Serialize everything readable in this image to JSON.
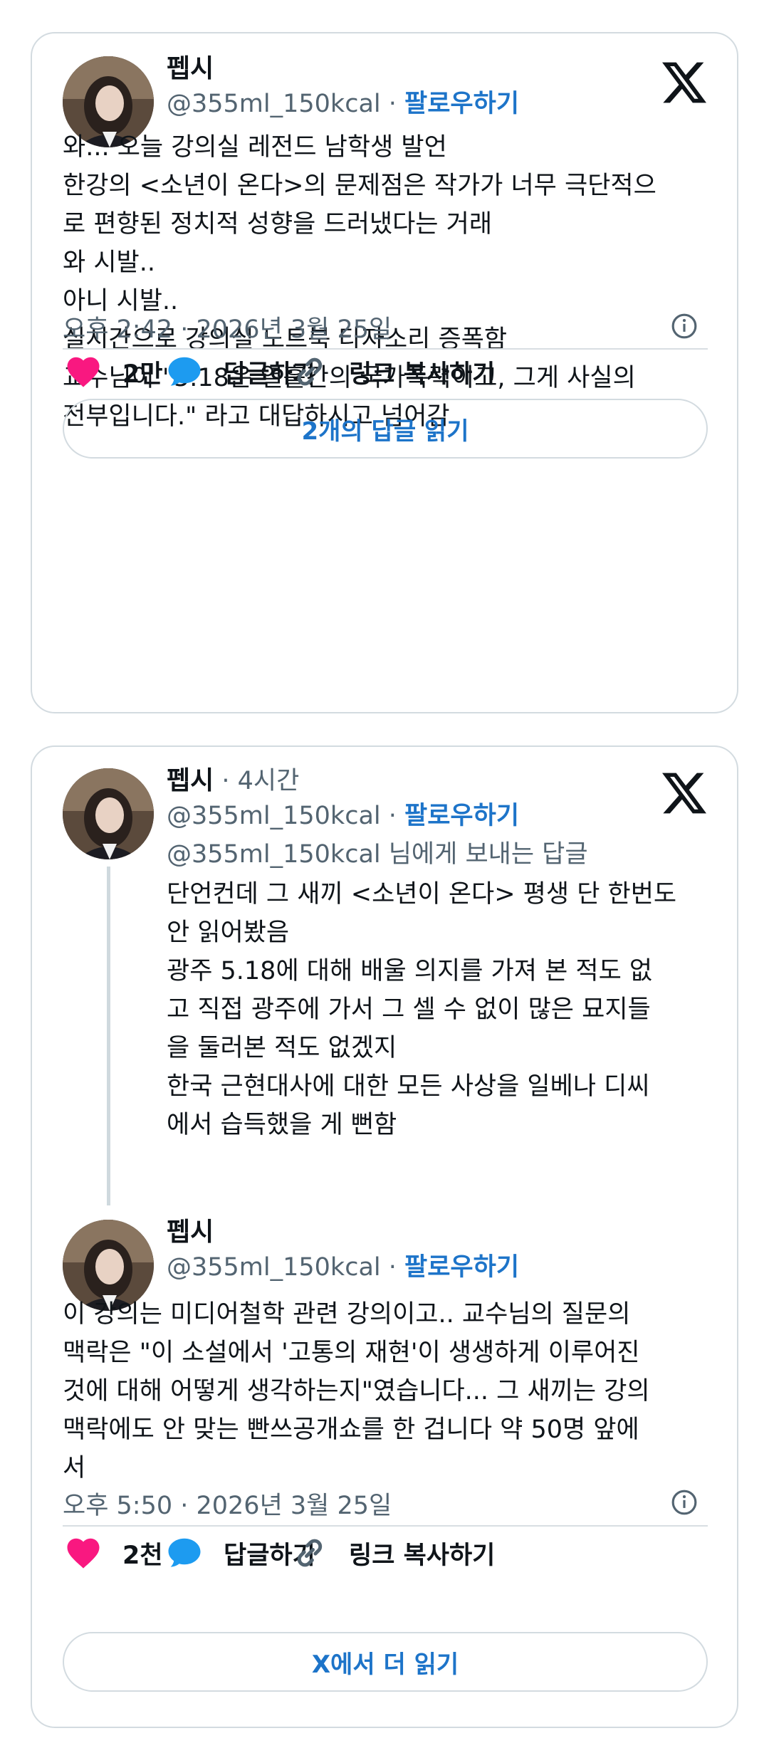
{
  "tweet1": {
    "name": "펩시",
    "handle": "@355ml_150kcal",
    "separator": " · ",
    "follow": "팔로우하기",
    "text": "와... 오늘 강의실 레전드 남학생 발언\n한강의 <소년이 온다>의 문제점은 작가가 너무 극단적으\n로 편향된 정치적 성향을 드러냈다는 거래\n와 시발..\n아니 시발..\n실시간으로 강의실 노트북 타자소리 증폭함\n교수님이 \"5.18은 열흘간의 국가폭력이고, 그게 사실의\n전부입니다.\" 라고 대답하시고 넘어감",
    "timestamp": "오후 2:42 · 2026년 3월 25일",
    "likes": "2만",
    "reply_label": "답글하기",
    "copy_link_label": "링크 복사하기",
    "read_replies": "2개의 답글 읽기"
  },
  "tweet2": {
    "reply": {
      "name": "펩시",
      "time": " · 4시간",
      "handle": "@355ml_150kcal",
      "separator": " · ",
      "follow": "팔로우하기",
      "reply_to": "@355ml_150kcal 님에게 보내는 답글",
      "text": "단언컨데 그 새끼 <소년이 온다> 평생 단 한번도\n안 읽어봤음\n광주 5.18에 대해 배울 의지를 가져 본 적도 없\n고 직접 광주에 가서 그 셀 수 없이 많은 묘지들\n을 둘러본 적도 없겠지\n한국 근현대사에 대한 모든 사상을 일베나 디씨\n에서 습득했을 게 뻔함"
    },
    "main": {
      "name": "펩시",
      "handle": "@355ml_150kcal",
      "separator": " · ",
      "follow": "팔로우하기",
      "text": "이 강의는 미디어철학 관련 강의이고.. 교수님의 질문의\n맥락은 \"이 소설에서 '고통의 재현'이 생생하게 이루어진\n것에 대해 어떻게 생각하는지\"였습니다... 그 새끼는 강의\n맥락에도 안 맞는 빤쓰공개쇼를 한 겁니다 약 50명 앞에\n서",
      "timestamp": "오후 5:50 · 2026년 3월 25일",
      "likes": "2천",
      "reply_label": "답글하기",
      "copy_link_label": "링크 복사하기",
      "read_more": "X에서 더 읽기"
    }
  },
  "icons": {
    "brand": "x-logo-icon",
    "like": "heart-icon",
    "reply": "speech-bubble-icon",
    "link": "link-icon",
    "info": "info-icon"
  },
  "colors": {
    "like": "#f91880",
    "reply": "#1d9bf0",
    "accent": "#1d74c9",
    "muted": "#536471"
  }
}
